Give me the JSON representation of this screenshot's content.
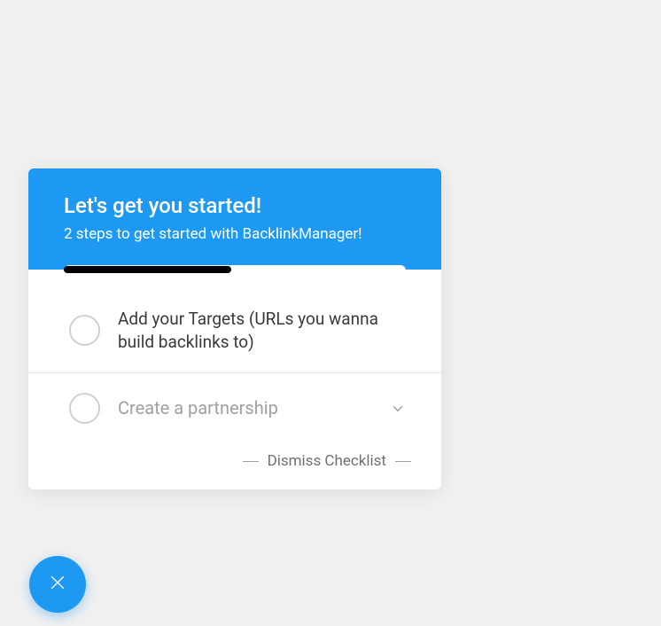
{
  "header": {
    "title": "Let's get you started!",
    "subtitle": "2 steps to get started with BacklinkManager!"
  },
  "items": [
    {
      "label": "Add your Targets (URLs you wanna build backlinks to)"
    },
    {
      "label": "Create a partnership"
    }
  ],
  "dismiss": {
    "label": "Dismiss Checklist"
  }
}
